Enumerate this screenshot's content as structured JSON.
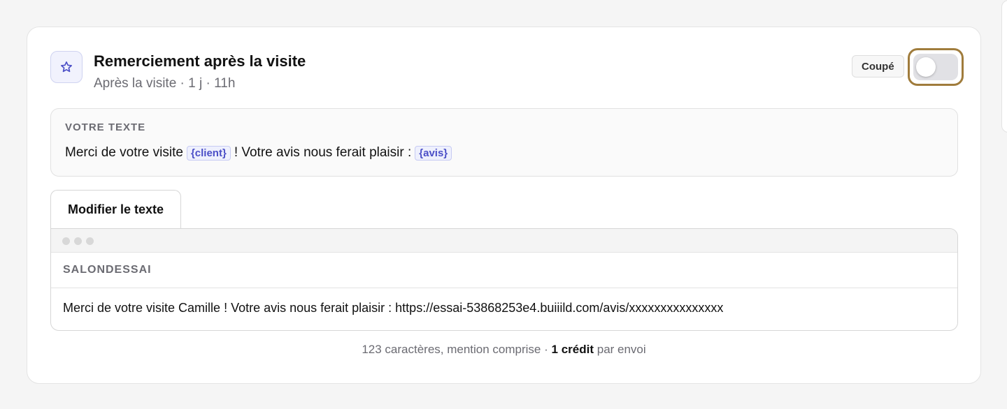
{
  "card": {
    "icon": "star-icon",
    "title": "Remerciement après la visite",
    "subtitle": "Après la visite · 1 j · 11h",
    "status": "Coupé",
    "toggle_on": false
  },
  "text_section": {
    "label": "VOTRE TEXTE",
    "parts": {
      "p1": "Merci de votre visite",
      "var1": "{client}",
      "p2": "! Votre avis nous ferait plaisir :",
      "var2": "{avis}"
    }
  },
  "edit_button_label": "Modifier le texte",
  "preview": {
    "sender": "SALONDESSAI",
    "message": "Merci de votre visite Camille ! Votre avis nous ferait plaisir : https://essai-53868253e4.buiiild.com/avis/xxxxxxxxxxxxxxx"
  },
  "footer": {
    "count_text": "123 caractères, mention comprise ·",
    "credit_text": "1 crédit",
    "suffix": "par envoi"
  },
  "colors": {
    "accent": "#4b4fc7",
    "focus_ring": "#a07c3c"
  }
}
